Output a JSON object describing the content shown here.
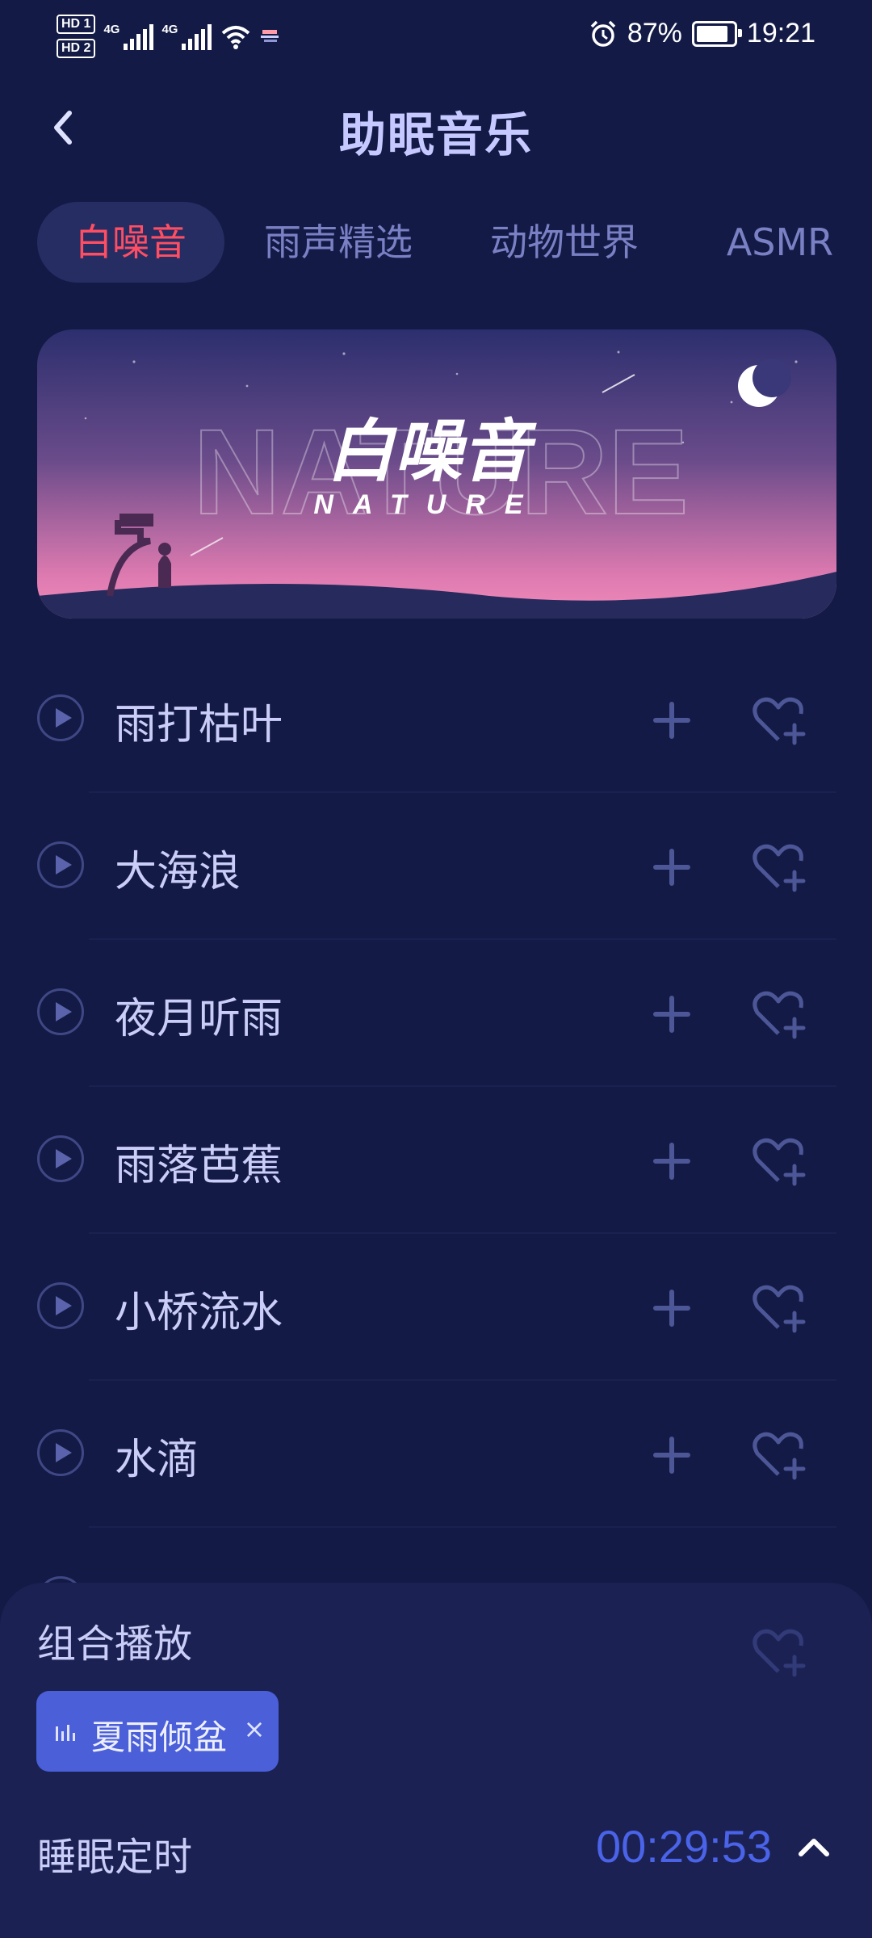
{
  "status_bar": {
    "hd1": "HD 1",
    "hd2": "HD 2",
    "net1": "4G",
    "net2": "4G",
    "battery_percent": "87%",
    "battery_level": 0.87,
    "time": "19:21",
    "icons": [
      "alarm-icon",
      "wifi-icon",
      "notification-icon",
      "battery-charging-icon"
    ]
  },
  "header": {
    "title": "助眠音乐",
    "back_icon": "chevron-left-icon"
  },
  "tabs": [
    {
      "label": "白噪音",
      "active": true
    },
    {
      "label": "雨声精选",
      "active": false
    },
    {
      "label": "动物世界",
      "active": false
    },
    {
      "label": "ASMR",
      "active": false
    }
  ],
  "banner": {
    "title": "白噪音",
    "subtitle": "NATURE",
    "background_word": "NATURE"
  },
  "tracks": [
    {
      "name": "雨打枯叶"
    },
    {
      "name": "大海浪"
    },
    {
      "name": "夜月听雨"
    },
    {
      "name": "雨落芭蕉"
    },
    {
      "name": "小桥流水"
    },
    {
      "name": "水滴"
    }
  ],
  "bottom_sheet": {
    "combo_label": "组合播放",
    "chip_label": "夏雨倾盆",
    "chip_close": "×",
    "timer_label": "睡眠定时",
    "timer_value": "00:29:53"
  },
  "colors": {
    "background": "#131a45",
    "accent_red": "#ff4e63",
    "accent_blue": "#4a5fd8",
    "timer_blue": "#4a63e8"
  }
}
